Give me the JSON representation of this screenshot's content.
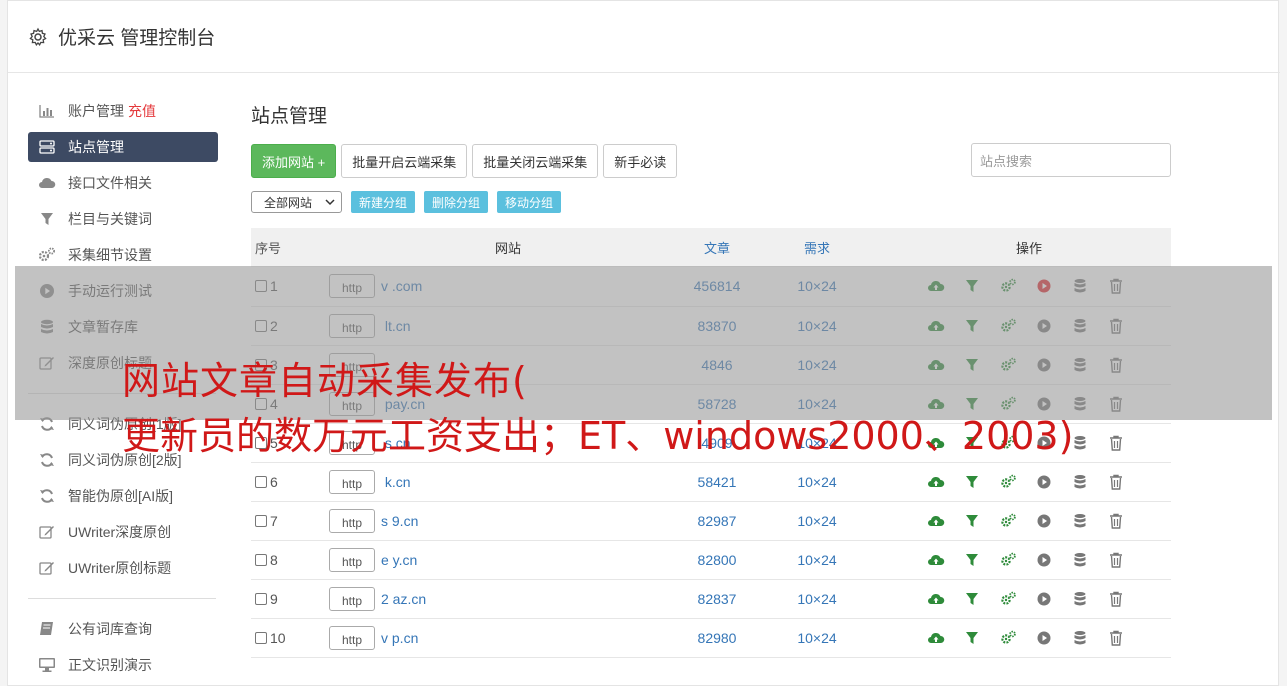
{
  "header": {
    "title": "优采云 管理控制台",
    "icon": "gear-icon"
  },
  "sidebar": {
    "items": [
      {
        "label": "账户管理",
        "badge": "充值",
        "icon": "bar-chart-icon"
      },
      {
        "label": "站点管理",
        "icon": "server-icon",
        "active": true
      },
      {
        "label": "接口文件相关",
        "icon": "cloud-icon"
      },
      {
        "label": "栏目与关键词",
        "icon": "filter-icon"
      },
      {
        "label": "采集细节设置",
        "icon": "cogs-icon"
      },
      {
        "label": "手动运行测试",
        "icon": "play-icon"
      },
      {
        "label": "文章暂存库",
        "icon": "database-icon"
      },
      {
        "label": "深度原创标题",
        "icon": "edit-icon"
      }
    ],
    "items2": [
      {
        "label": "同义词伪原创[1版]",
        "icon": "refresh-icon"
      },
      {
        "label": "同义词伪原创[2版]",
        "icon": "refresh-icon"
      },
      {
        "label": "智能伪原创[AI版]",
        "icon": "refresh-icon"
      },
      {
        "label": "UWriter深度原创",
        "icon": "edit-icon"
      },
      {
        "label": "UWriter原创标题",
        "icon": "edit-icon"
      }
    ],
    "items3": [
      {
        "label": "公有词库查询",
        "icon": "book-icon"
      },
      {
        "label": "正文识别演示",
        "icon": "monitor-icon"
      }
    ]
  },
  "main": {
    "title": "站点管理",
    "buttons": {
      "add": "添加网站 +",
      "batch_on": "批量开启云端采集",
      "batch_off": "批量关闭云端采集",
      "newbie": "新手必读"
    },
    "search_placeholder": "站点搜索",
    "select_value": "全部网站",
    "group_buttons": {
      "new": "新建分组",
      "delete": "删除分组",
      "move": "移动分组"
    },
    "table": {
      "headers": {
        "idx": "序号",
        "site": "网站",
        "articles": "文章",
        "demand": "需求",
        "ops": "操作"
      },
      "rows": [
        {
          "idx": "1",
          "proto": "http",
          "domain": "v           .com",
          "articles": "456814",
          "demand": "10×24",
          "running": true
        },
        {
          "idx": "2",
          "proto": "http",
          "domain": "      lt.cn",
          "articles": "83870",
          "demand": "10×24",
          "running": false
        },
        {
          "idx": "3",
          "proto": "http",
          "domain": "            ",
          "articles": "4846",
          "demand": "10×24",
          "running": false
        },
        {
          "idx": "4",
          "proto": "http",
          "domain": "       pay.cn",
          "articles": "58728",
          "demand": "10×24",
          "running": false
        },
        {
          "idx": "5",
          "proto": "http",
          "domain": "      s.cn",
          "articles": "4909",
          "demand": "10×24",
          "running": false
        },
        {
          "idx": "6",
          "proto": "http",
          "domain": "      k.cn",
          "articles": "58421",
          "demand": "10×24",
          "running": false
        },
        {
          "idx": "7",
          "proto": "http",
          "domain": "s    9.cn",
          "articles": "82987",
          "demand": "10×24",
          "running": false
        },
        {
          "idx": "8",
          "proto": "http",
          "domain": "e     y.cn",
          "articles": "82800",
          "demand": "10×24",
          "running": false
        },
        {
          "idx": "9",
          "proto": "http",
          "domain": "2     az.cn",
          "articles": "82837",
          "demand": "10×24",
          "running": false
        },
        {
          "idx": "10",
          "proto": "http",
          "domain": "v     p.cn",
          "articles": "82980",
          "demand": "10×24",
          "running": false
        }
      ]
    }
  },
  "overlay": {
    "line1": "网站文章自动采集发布(",
    "line2": "更新员的数万元工资支出；ET、windows2000、2003)"
  },
  "colors": {
    "primary_green": "#5cb85c",
    "info_blue": "#5bc0de",
    "sidebar_active": "#3d4a63",
    "link_blue": "#3576b7",
    "overlay_red": "#d01818"
  }
}
